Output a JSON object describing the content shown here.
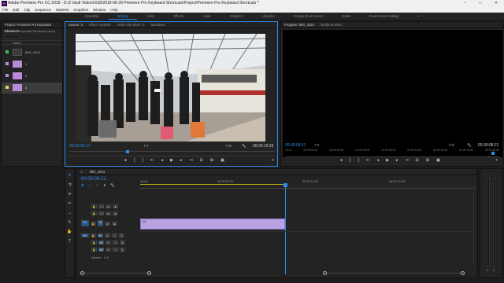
{
  "window": {
    "title": "Adobe Premiere Pro CC 2018 - D:\\2 Vault Video\\2018\\2018-08-29 Premiere Pro Keyboard Shortcuts\\Project\\Premiere Pro Keyboard Shortcuts *",
    "app_icon": "Pr",
    "min": "–",
    "max": "□",
    "close": "✕"
  },
  "menu": [
    "File",
    "Edit",
    "Clip",
    "Sequence",
    "Markers",
    "Graphics",
    "Window",
    "Help"
  ],
  "workspaces": {
    "items": [
      "Assembly",
      "Editing",
      "Color",
      "Effects",
      "Audio",
      "Graphics",
      "Libraries",
      "Google Dual Screen",
      "Notes",
      "Dual Screen Editing"
    ],
    "active_index": 1,
    "overflow": "»"
  },
  "project": {
    "tab": "Project: Premiere Pro Keyboard Shortcuts",
    "path": "Premier... Keyboard Shortcuts.prproj",
    "column_header": "Name",
    "items": [
      {
        "name": "IMG_4224",
        "color": "#3fbf5a",
        "type": "sequence"
      },
      {
        "name": "1",
        "color": "#b98ad8",
        "type": "clip"
      },
      {
        "name": "2",
        "color": "#b98ad8",
        "type": "clip"
      },
      {
        "name": "3",
        "color": "#e8d25a",
        "type": "clip"
      }
    ]
  },
  "source_monitor": {
    "tabs": [
      "Source: 3",
      "Effect Controls",
      "Audio Clip Mixer: 3",
      "Metadata"
    ],
    "timecode_in": "00:00:09:17",
    "zoom": "Fit",
    "resolution": "Full",
    "timecode_duration": "00:00:19:25",
    "playhead_fraction": 0.285
  },
  "program_monitor": {
    "tabs": [
      "Program: IMG_4224",
      "Media Browser"
    ],
    "timecode": "00:00:08:21",
    "zoom": "Fit",
    "resolution": "Full",
    "timecode_duration": "00:00:08:21",
    "ruler": [
      "00:00",
      "00:00:02:00",
      "00:00:04:00",
      "00:00:06:00",
      "00:00:08:00",
      "00:00:10:00",
      "00:00:12:00",
      "00:00:14:00",
      "00:00:16:00"
    ],
    "playhead_fraction": 0.97
  },
  "timeline": {
    "sequence_tab": "IMG_4224",
    "timecode": "00:00:08:21",
    "ruler": [
      "00:00",
      "00:00:05:00",
      "00:00:10:00",
      "00:00:15:00"
    ],
    "playhead_fraction": 0.433,
    "clip": {
      "label": "[V]",
      "color": "#b9a2e0",
      "start_fraction": 0.0,
      "end_fraction": 0.433
    },
    "video_tracks": [
      "V3",
      "V2",
      "V1"
    ],
    "audio_tracks": [
      "A1",
      "A2",
      "A3"
    ],
    "master": "Master",
    "master_value": "0.0",
    "source_patch_v": "V1",
    "source_patch_a": "A1",
    "track_toggles": {
      "mute": "M",
      "solo": "S",
      "lock": "🔒",
      "eye": "👁"
    }
  },
  "accent": "#2d8ceb"
}
